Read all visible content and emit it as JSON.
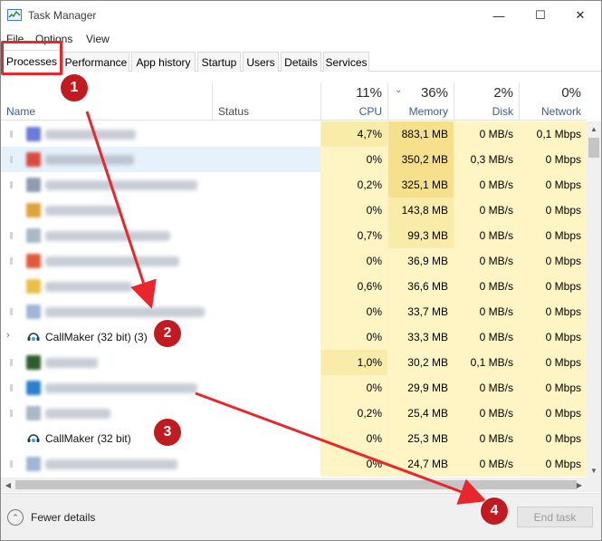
{
  "window": {
    "title": "Task Manager",
    "controls": {
      "minimize": "—",
      "maximize": "☐",
      "close": "✕"
    }
  },
  "menu": {
    "file": "File",
    "options": "Options",
    "view": "View"
  },
  "tabs": [
    "Processes",
    "Performance",
    "App history",
    "Startup",
    "Users",
    "Details",
    "Services"
  ],
  "active_tab": "Processes",
  "columns": {
    "name": "Name",
    "status": "Status",
    "cpu": {
      "percent": "11%",
      "label": "CPU"
    },
    "memory": {
      "percent": "36%",
      "label": "Memory",
      "sort_icon": "chevron-down-icon"
    },
    "disk": {
      "percent": "2%",
      "label": "Disk"
    },
    "network": {
      "percent": "0%",
      "label": "Network"
    }
  },
  "rows": [
    {
      "name": "",
      "blurred": true,
      "expander": "dot",
      "icon": "blurred-app-icon",
      "icon_color": "#6a7bd8",
      "cpu": "4,7%",
      "memory": "883,1 MB",
      "disk": "0 MB/s",
      "network": "0,1 Mbps"
    },
    {
      "name": "",
      "blurred": true,
      "expander": "dot",
      "icon": "blurred-app-icon",
      "icon_color": "#d94b3f",
      "cpu": "0%",
      "memory": "350,2 MB",
      "disk": "0,3 MB/s",
      "network": "0 Mbps",
      "selected": true
    },
    {
      "name": "",
      "blurred": true,
      "expander": "dot",
      "icon": "blurred-app-icon",
      "icon_color": "#8f9bb0",
      "cpu": "0,2%",
      "memory": "325,1 MB",
      "disk": "0 MB/s",
      "network": "0 Mbps"
    },
    {
      "name": "",
      "blurred": true,
      "expander": "none",
      "icon": "blurred-app-icon",
      "icon_color": "#e0a23a",
      "cpu": "0%",
      "memory": "143,8 MB",
      "disk": "0 MB/s",
      "network": "0 Mbps"
    },
    {
      "name": "",
      "blurred": true,
      "expander": "dot",
      "icon": "blurred-app-icon",
      "icon_color": "#a9b7c7",
      "cpu": "0,7%",
      "memory": "99,3 MB",
      "disk": "0 MB/s",
      "network": "0 Mbps"
    },
    {
      "name": "",
      "blurred": true,
      "expander": "dot",
      "icon": "blurred-app-icon",
      "icon_color": "#e05a3a",
      "cpu": "0%",
      "memory": "36,9 MB",
      "disk": "0 MB/s",
      "network": "0 Mbps"
    },
    {
      "name": "",
      "blurred": true,
      "expander": "none",
      "icon": "blurred-app-icon",
      "icon_color": "#e8c04a",
      "cpu": "0,6%",
      "memory": "36,6 MB",
      "disk": "0 MB/s",
      "network": "0 Mbps"
    },
    {
      "name": "",
      "blurred": true,
      "expander": "dot",
      "icon": "blurred-app-icon",
      "icon_color": "#9fb6d6",
      "cpu": "0%",
      "memory": "33,7 MB",
      "disk": "0 MB/s",
      "network": "0 Mbps"
    },
    {
      "name": "CallMaker (32 bit) (3)",
      "blurred": false,
      "expander": "arrow",
      "icon": "callmaker-icon",
      "icon_color": "#1e3a56",
      "cpu": "0%",
      "memory": "33,3 MB",
      "disk": "0 MB/s",
      "network": "0 Mbps"
    },
    {
      "name": "",
      "blurred": true,
      "expander": "dot",
      "icon": "blurred-app-icon",
      "icon_color": "#2e5c2a",
      "cpu": "1,0%",
      "memory": "30,2 MB",
      "disk": "0,1 MB/s",
      "network": "0 Mbps"
    },
    {
      "name": "",
      "blurred": true,
      "expander": "dot",
      "icon": "blurred-app-icon",
      "icon_color": "#2f7fd0",
      "cpu": "0%",
      "memory": "29,9 MB",
      "disk": "0 MB/s",
      "network": "0 Mbps"
    },
    {
      "name": "",
      "blurred": true,
      "expander": "dot",
      "icon": "blurred-app-icon",
      "icon_color": "#a9b7c7",
      "cpu": "0,2%",
      "memory": "25,4 MB",
      "disk": "0 MB/s",
      "network": "0 Mbps"
    },
    {
      "name": "CallMaker (32 bit)",
      "blurred": false,
      "expander": "none",
      "icon": "callmaker-icon",
      "icon_color": "#1e3a56",
      "cpu": "0%",
      "memory": "25,3 MB",
      "disk": "0 MB/s",
      "network": "0 Mbps"
    },
    {
      "name": "",
      "blurred": true,
      "expander": "dot",
      "icon": "blurred-app-icon",
      "icon_color": "#9fb6d6",
      "cpu": "0%",
      "memory": "24,7 MB",
      "disk": "0 MB/s",
      "network": "0 Mbps"
    }
  ],
  "footer": {
    "fewer_details": "Fewer details",
    "end_task": "End task"
  },
  "annotations": [
    "1",
    "2",
    "3",
    "4"
  ],
  "colors": {
    "heat_light": "#fff4c4",
    "heat_medium": "#f9eca8",
    "heat_strong": "#f7e08c",
    "selected_row": "#e5f1fb",
    "annotation_red": "#e8262b"
  }
}
